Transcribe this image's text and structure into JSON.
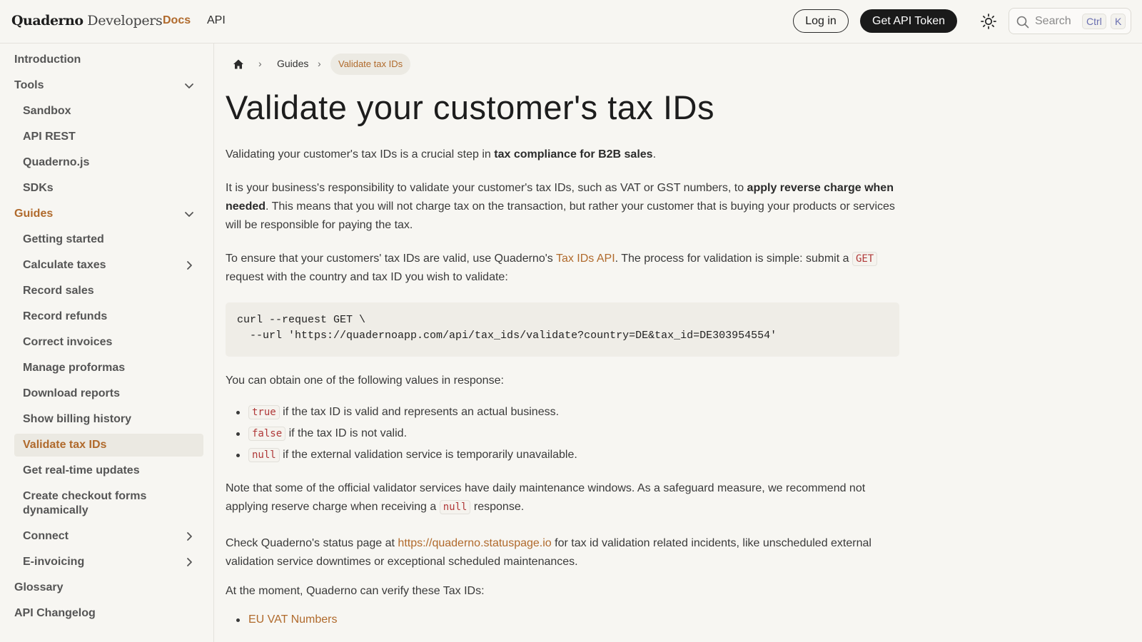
{
  "header": {
    "logo_brand": "Quaderno",
    "logo_suffix": " Developers",
    "nav": [
      {
        "label": "Docs"
      },
      {
        "label": "API"
      }
    ],
    "login_label": "Log in",
    "token_label": "Get API Token",
    "search_placeholder": "Search",
    "search_kbd_1": "Ctrl",
    "search_kbd_2": "K",
    "accent_color": "#b06a2c"
  },
  "sidebar": {
    "items": [
      {
        "label": "Introduction"
      },
      {
        "label": "Tools"
      },
      {
        "label": "Sandbox"
      },
      {
        "label": "API REST"
      },
      {
        "label": "Quaderno.js"
      },
      {
        "label": "SDKs"
      },
      {
        "label": "Guides"
      },
      {
        "label": "Getting started"
      },
      {
        "label": "Calculate taxes"
      },
      {
        "label": "Record sales"
      },
      {
        "label": "Record refunds"
      },
      {
        "label": "Correct invoices"
      },
      {
        "label": "Manage proformas"
      },
      {
        "label": "Download reports"
      },
      {
        "label": "Show billing history"
      },
      {
        "label": "Validate tax IDs"
      },
      {
        "label": "Get real-time updates"
      },
      {
        "label": "Create checkout forms dynamically"
      },
      {
        "label": "Connect"
      },
      {
        "label": "E-invoicing"
      },
      {
        "label": "Glossary"
      },
      {
        "label": "API Changelog"
      }
    ]
  },
  "breadcrumb": {
    "guides": "Guides",
    "current": "Validate tax IDs"
  },
  "main": {
    "title": "Validate your customer's tax IDs",
    "p1_a": "Validating your customer's tax IDs is a crucial step in ",
    "p1_b": "tax compliance for B2B sales",
    "p1_c": ".",
    "p2_a": "It is your business's responsibility to validate your customer's tax IDs, such as VAT or GST numbers, to ",
    "p2_b": "apply reverse charge when needed",
    "p2_c": ". This means that you will not charge tax on the transaction, but rather your customer that is buying your products or services will be responsible for paying the tax.",
    "p3_a": "To ensure that your customers' tax IDs are valid, use Quaderno's ",
    "p3_link": "Tax IDs API",
    "p3_b": ". The process for validation is simple: submit a ",
    "p3_code": "GET",
    "p3_c": " request with the country and tax ID you wish to validate:",
    "code_line1": "curl --request GET \\",
    "code_line2": "  --url 'https://quadernoapp.com/api/tax_ids/validate?country=DE&tax_id=DE303954554'",
    "p4": "You can obtain one of the following values in response:",
    "values": [
      {
        "code": "true",
        "text": " if the tax ID is valid and represents an actual business."
      },
      {
        "code": "false",
        "text": " if the tax ID is not valid."
      },
      {
        "code": "null",
        "text": " if the external validation service is temporarily unavailable."
      }
    ],
    "p5_a": "Note that some of the official validator services have daily maintenance windows. As a safeguard measure, we recommend not applying reserve charge when receiving a ",
    "p5_code": "null",
    "p5_b": " response.",
    "p6_a": "Check Quaderno's status page at ",
    "p6_link": "https://quaderno.statuspage.io",
    "p6_b": " for tax id validation related incidents, like unscheduled external validation service downtimes or exceptional scheduled maintenances.",
    "p7": "At the moment, Quaderno can verify these Tax IDs:",
    "taxid_links": [
      {
        "label": "EU VAT Numbers"
      }
    ]
  }
}
